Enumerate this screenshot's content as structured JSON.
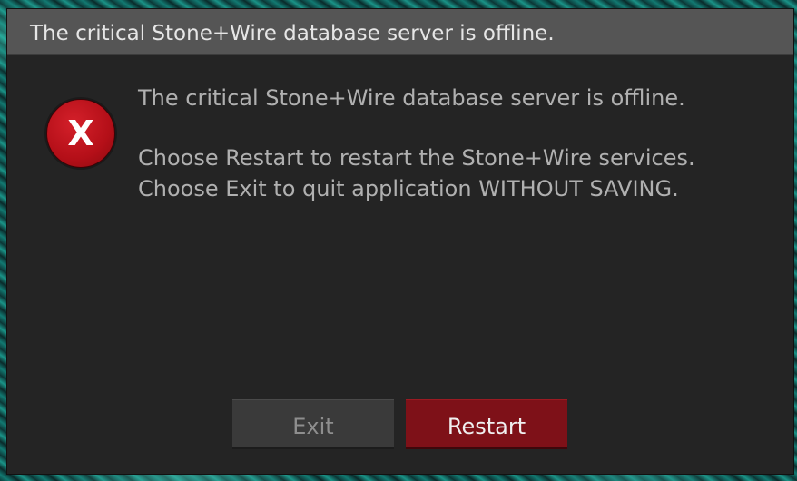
{
  "dialog": {
    "title": "The critical Stone+Wire database server is offline.",
    "icon": "error-x-icon",
    "message_line1": "The critical Stone+Wire database server is offline.",
    "message_line2": "Choose Restart to restart the Stone+Wire services.",
    "message_line3": "Choose Exit to quit application WITHOUT SAVING.",
    "icon_glyph": "X",
    "buttons": {
      "exit_label": "Exit",
      "restart_label": "Restart"
    }
  },
  "colors": {
    "dialog_bg": "#242424",
    "titlebar_bg": "#555555",
    "error_red": "#b40f18",
    "restart_bg": "#7e1118",
    "exit_bg": "#3a3a3a"
  }
}
